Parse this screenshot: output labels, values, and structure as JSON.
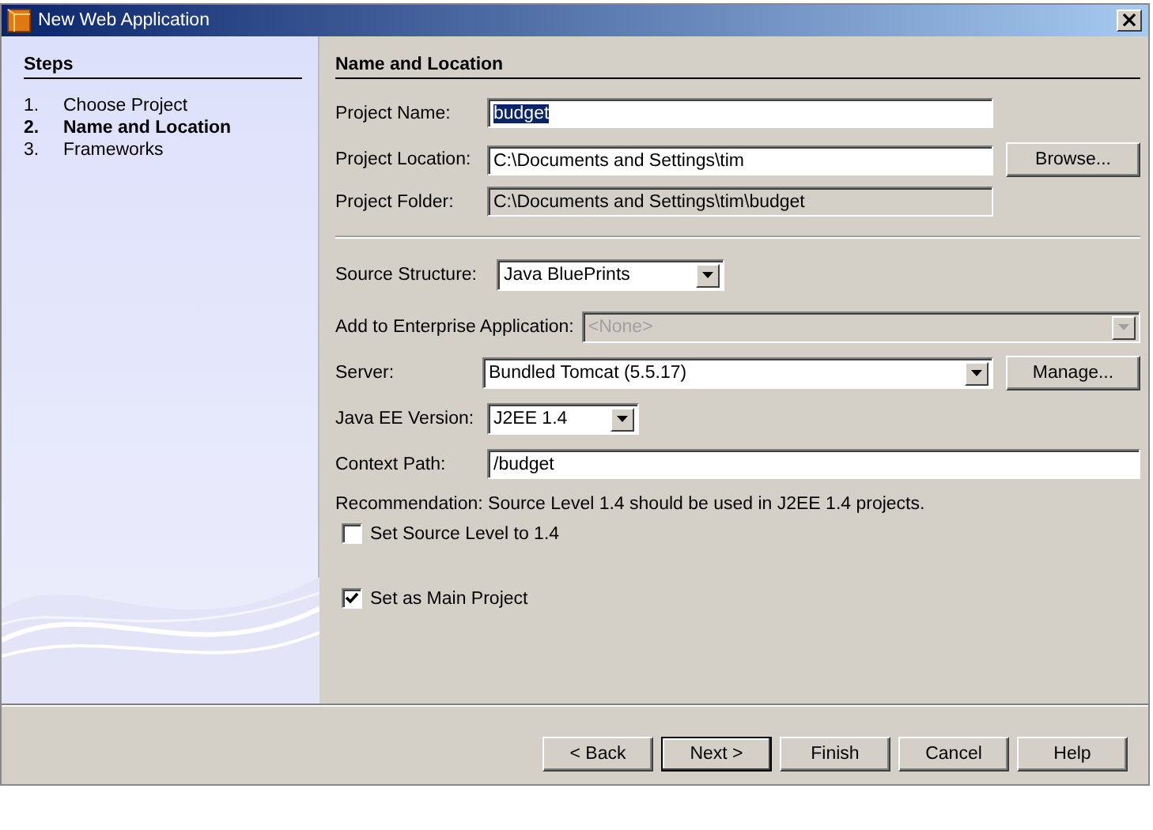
{
  "window": {
    "title": "New Web Application",
    "close": "×"
  },
  "steps": {
    "title": "Steps",
    "items": [
      {
        "number": "1.",
        "label": "Choose Project",
        "selected": false
      },
      {
        "number": "2.",
        "label": "Name and Location",
        "selected": true
      },
      {
        "number": "3.",
        "label": "Frameworks",
        "selected": false
      }
    ]
  },
  "panel": {
    "title": "Name and Location"
  },
  "rows": [
    {
      "kind": "text",
      "label": "Project Name:",
      "value": "budget",
      "text_selected": true,
      "disabled": false
    },
    {
      "kind": "text",
      "label": "Project Location:",
      "value": "C:\\Documents and Settings\\tim",
      "disabled": false,
      "button": "Browse..."
    },
    {
      "kind": "text",
      "label": "Project Folder:",
      "value": "C:\\Documents and Settings\\tim\\budget",
      "disabled": true
    },
    {
      "kind": "separator"
    },
    {
      "kind": "combo",
      "label": "Source Structure:",
      "value": "Java BluePrints",
      "disabled": false
    },
    {
      "kind": "combo",
      "label": "Add to Enterprise Application:",
      "value": "<None>",
      "disabled": true
    },
    {
      "kind": "combo",
      "label": "Server:",
      "value": "Bundled Tomcat (5.5.17)",
      "disabled": false,
      "button": "Manage..."
    },
    {
      "kind": "combo",
      "label": "Java EE Version:",
      "value": "J2EE 1.4",
      "disabled": false
    },
    {
      "kind": "text",
      "label": "Context Path:",
      "value": "/budget",
      "disabled": false
    },
    {
      "kind": "note",
      "text": "Recommendation: Source Level 1.4 should be used in J2EE 1.4 projects."
    },
    {
      "kind": "checkbox",
      "label": "Set Source Level to 1.4",
      "checked": false
    },
    {
      "kind": "checkbox",
      "label": "Set as Main Project",
      "checked": true
    }
  ],
  "buttons": [
    {
      "label": "< Back",
      "default": false
    },
    {
      "label": "Next >",
      "default": true
    },
    {
      "label": "Finish",
      "default": false
    },
    {
      "label": "Cancel",
      "default": false
    },
    {
      "label": "Help",
      "default": false
    }
  ]
}
